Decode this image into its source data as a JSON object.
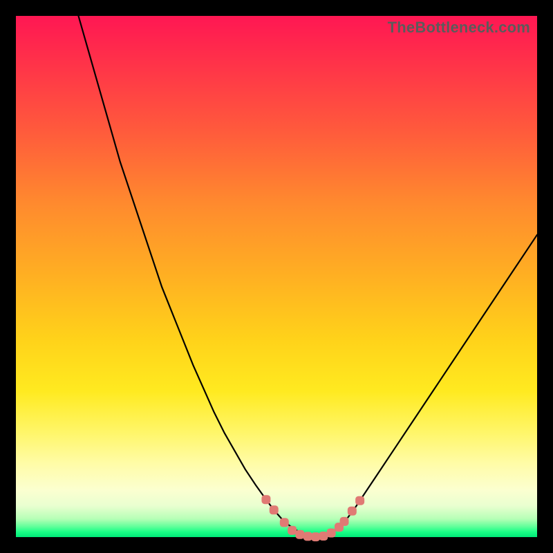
{
  "watermark": "TheBottleneck.com",
  "colors": {
    "curve": "#000000",
    "marker_fill": "#e07a74",
    "marker_stroke": "#c95a55"
  },
  "chart_data": {
    "type": "line",
    "title": "",
    "xlabel": "",
    "ylabel": "",
    "xlim": [
      0,
      100
    ],
    "ylim": [
      0,
      100
    ],
    "note": "V-shaped bottleneck curve; y is bottleneck percentage (0 at valley). Axes unlabeled in source image; x estimated as normalized hardware-balance axis.",
    "series": [
      {
        "name": "left-branch",
        "x": [
          12,
          14,
          16,
          18,
          20,
          22,
          24,
          26,
          28,
          30,
          32,
          34,
          36,
          38,
          40,
          42,
          44,
          46,
          48,
          49.5,
          51,
          52.5,
          54,
          56,
          58
        ],
        "y": [
          100,
          93,
          86,
          79,
          72,
          66,
          60,
          54,
          48,
          43,
          38,
          33,
          28.5,
          24,
          20,
          16.5,
          13,
          10,
          7.2,
          5.2,
          3.5,
          2.2,
          1.2,
          0.4,
          0.05
        ]
      },
      {
        "name": "right-branch",
        "x": [
          58,
          60,
          62,
          63.5,
          65,
          67,
          70,
          73,
          76,
          80,
          84,
          88,
          92,
          96,
          100
        ],
        "y": [
          0.05,
          0.5,
          1.8,
          3.5,
          5.5,
          8.5,
          13,
          17.5,
          22,
          28,
          34,
          40,
          46,
          52,
          58
        ]
      }
    ],
    "markers": {
      "name": "highlighted-points",
      "points": [
        {
          "x": 48.0,
          "y": 7.2
        },
        {
          "x": 49.5,
          "y": 5.2
        },
        {
          "x": 51.5,
          "y": 2.8
        },
        {
          "x": 53.0,
          "y": 1.3
        },
        {
          "x": 54.5,
          "y": 0.5
        },
        {
          "x": 56.0,
          "y": 0.15
        },
        {
          "x": 57.5,
          "y": 0.05
        },
        {
          "x": 59.0,
          "y": 0.2
        },
        {
          "x": 60.5,
          "y": 0.8
        },
        {
          "x": 62.0,
          "y": 1.9
        },
        {
          "x": 63.0,
          "y": 3.0
        },
        {
          "x": 64.5,
          "y": 5.0
        },
        {
          "x": 66.0,
          "y": 7.0
        }
      ]
    }
  }
}
